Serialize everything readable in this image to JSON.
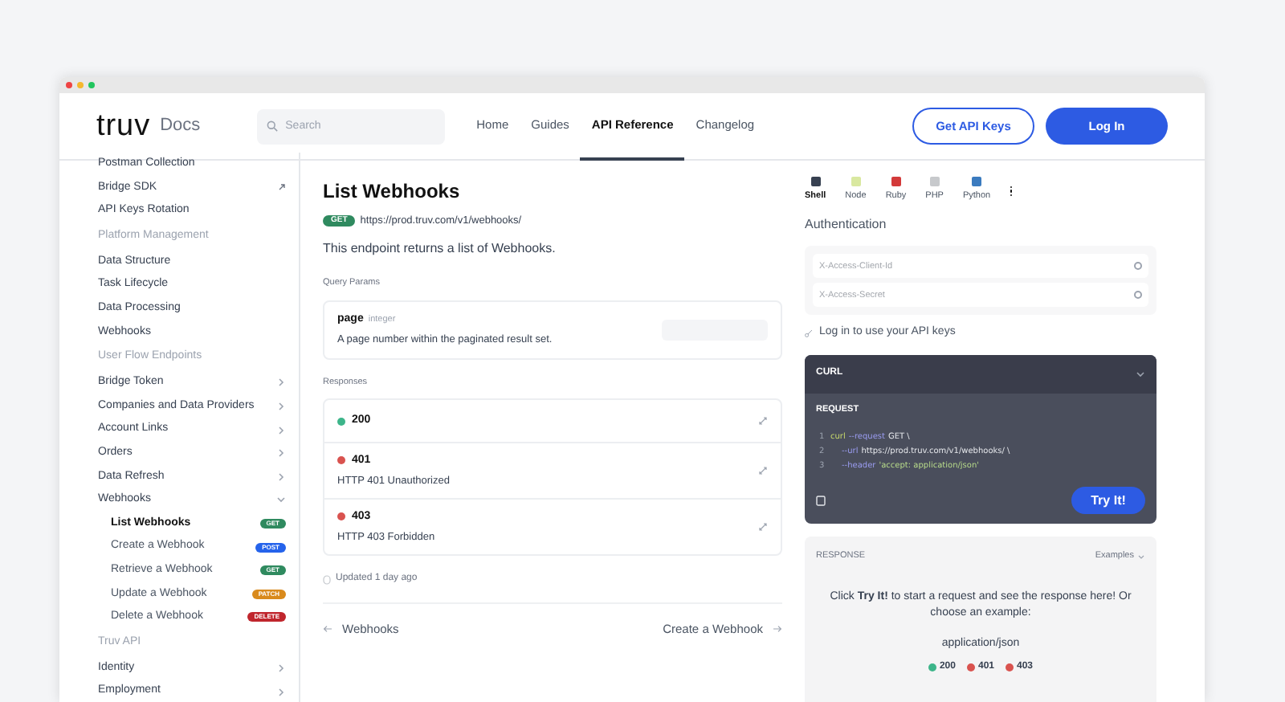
{
  "header": {
    "logo": "truv",
    "logo_suffix": "Docs",
    "search": {
      "placeholder": "Search"
    },
    "nav": [
      {
        "label": "Home",
        "selected": false
      },
      {
        "label": "Guides",
        "selected": false
      },
      {
        "label": "API Reference",
        "selected": true
      },
      {
        "label": "Changelog",
        "selected": false
      }
    ],
    "buttons": [
      {
        "label": "Get API Keys",
        "kind": "outline"
      },
      {
        "label": "Log In",
        "kind": "primary"
      }
    ]
  },
  "sidebar": {
    "items": [
      {
        "label": "Postman Collection",
        "kind": "link"
      },
      {
        "label": "Bridge SDK",
        "kind": "external"
      },
      {
        "label": "API Keys Rotation",
        "kind": "link"
      },
      {
        "label": "Platform Management",
        "kind": "heading"
      },
      {
        "label": "Data Structure",
        "kind": "link"
      },
      {
        "label": "Task Lifecycle",
        "kind": "link"
      },
      {
        "label": "Data Processing",
        "kind": "link"
      },
      {
        "label": "Webhooks",
        "kind": "link"
      },
      {
        "label": "User Flow Endpoints",
        "kind": "heading"
      },
      {
        "label": "Bridge Token",
        "kind": "group",
        "expanded": false
      },
      {
        "label": "Companies and Data Providers",
        "kind": "group",
        "expanded": false
      },
      {
        "label": "Account Links",
        "kind": "group",
        "expanded": false
      },
      {
        "label": "Orders",
        "kind": "group",
        "expanded": false
      },
      {
        "label": "Data Refresh",
        "kind": "group",
        "expanded": false
      },
      {
        "label": "Webhooks",
        "kind": "group",
        "expanded": true,
        "children": [
          {
            "label": "List Webhooks",
            "method": "GET",
            "selected": true
          },
          {
            "label": "Create a Webhook",
            "method": "POST",
            "selected": false
          },
          {
            "label": "Retrieve a Webhook",
            "method": "GET",
            "selected": false
          },
          {
            "label": "Update a Webhook",
            "method": "PATCH",
            "selected": false
          },
          {
            "label": "Delete a Webhook",
            "method": "DELETE",
            "selected": false
          }
        ]
      },
      {
        "label": "Truv API",
        "kind": "heading"
      },
      {
        "label": "Identity",
        "kind": "group",
        "expanded": false
      },
      {
        "label": "Employment",
        "kind": "group",
        "expanded": false
      }
    ]
  },
  "main": {
    "title": "List Webhooks",
    "method": "GET",
    "url": "https://prod.truv.com/v1/webhooks/",
    "description": "This endpoint returns a list of Webhooks.",
    "query_label": "Query Params",
    "param": {
      "name": "page",
      "type": "integer",
      "description": "A page number within the paginated result set."
    },
    "responses_label": "Responses",
    "responses": [
      {
        "code": "200",
        "color": "#3db58a"
      },
      {
        "code": "401",
        "description": "HTTP 401 Unauthorized",
        "color": "#d9534f"
      },
      {
        "code": "403",
        "description": "HTTP 403 Forbidden",
        "color": "#d9534f"
      }
    ],
    "updated": "Updated 1 day ago",
    "prev": "Webhooks",
    "next": "Create a Webhook"
  },
  "right": {
    "languages": [
      {
        "label": "Shell",
        "selected": true
      },
      {
        "label": "Node",
        "selected": false
      },
      {
        "label": "Ruby",
        "selected": false
      },
      {
        "label": "PHP",
        "selected": false
      },
      {
        "label": "Python",
        "selected": false
      }
    ],
    "auth_title": "Authentication",
    "auth_fields": [
      {
        "placeholder": "X-Access-Client-Id"
      },
      {
        "placeholder": "X-Access-Secret"
      }
    ],
    "login_hint": "Log in to use your API keys",
    "curl": {
      "title": "CURL",
      "request_label": "REQUEST",
      "lines": [
        {
          "number": "1",
          "indent": false,
          "parts": [
            {
              "text": "curl",
              "kind": "command"
            },
            {
              "text": "--request",
              "kind": "flag"
            },
            {
              "text": "GET \\",
              "kind": "plain"
            }
          ]
        },
        {
          "number": "2",
          "indent": true,
          "parts": [
            {
              "text": "--url",
              "kind": "flag"
            },
            {
              "text": "https://prod.truv.com/v1/webhooks/ \\",
              "kind": "plain"
            }
          ]
        },
        {
          "number": "3",
          "indent": true,
          "parts": [
            {
              "text": "--header",
              "kind": "flag"
            },
            {
              "text": "'accept: application/json'",
              "kind": "string"
            }
          ]
        }
      ],
      "button": "Try It!"
    },
    "response": {
      "title": "RESPONSE",
      "examples": "Examples",
      "message": "Click **Try It!** to start a request and see the response here! Or choose an example:",
      "media_type": "application/json",
      "codes": [
        {
          "code": "200",
          "color": "#3db58a"
        },
        {
          "code": "401",
          "color": "#d9534f"
        },
        {
          "code": "403",
          "color": "#d9534f"
        }
      ]
    }
  }
}
